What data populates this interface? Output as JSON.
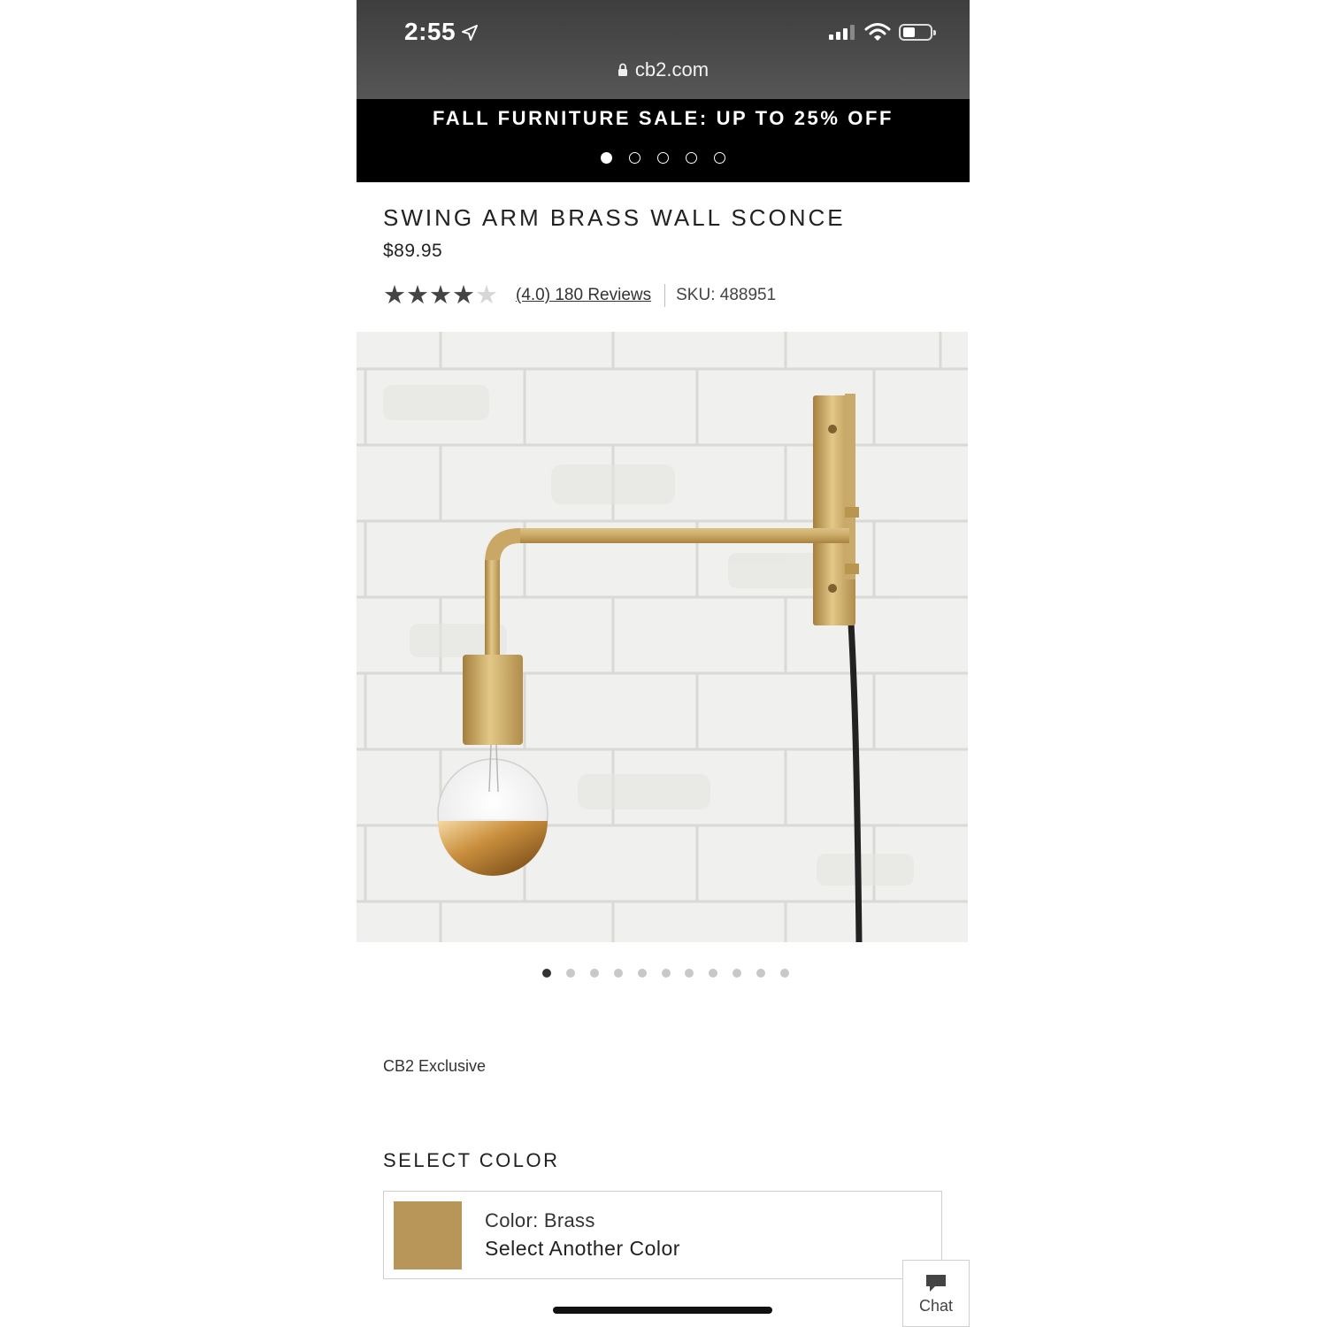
{
  "status_bar": {
    "time": "2:55",
    "url": "cb2.com"
  },
  "promo": {
    "text": "FALL FURNITURE SALE: UP TO 25% OFF",
    "slide_count": 5,
    "active_slide": 1
  },
  "product": {
    "title": "SWING ARM BRASS WALL SCONCE",
    "price": "$89.95",
    "rating_value": 4.0,
    "rating_max": 5,
    "reviews_link": "(4.0) 180 Reviews",
    "sku": "SKU: 488951",
    "image_count": 11,
    "active_image": 1,
    "exclusive": "CB2 Exclusive"
  },
  "color": {
    "heading": "SELECT COLOR",
    "label": "Color: Brass",
    "change_link": "Select Another Color",
    "swatch": "#b8965a"
  },
  "chat": {
    "label": "Chat"
  }
}
